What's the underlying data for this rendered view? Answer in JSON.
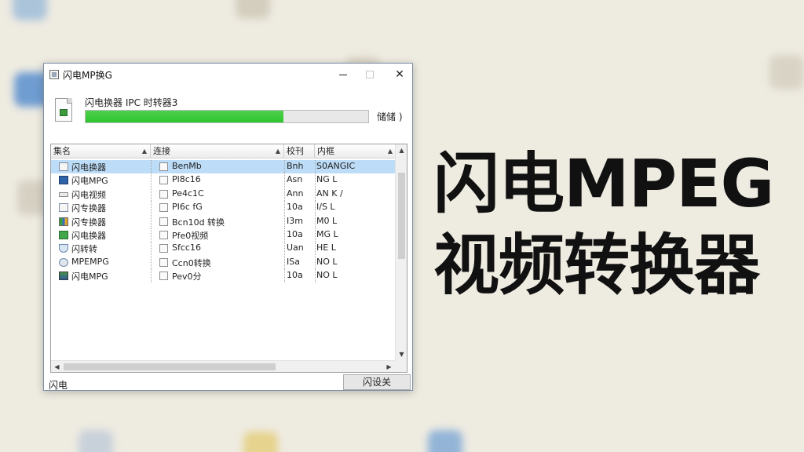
{
  "window": {
    "title": "闪电MP换G",
    "status_text": "闪电换器 IPC 时转器3",
    "progress_percent": 70,
    "progress_color": "#2ec42e",
    "detail_label": "储储 )",
    "footer_label": "闪电",
    "close_button_label": "闪设关"
  },
  "list": {
    "columns": [
      "集名",
      "连接",
      "校刊",
      "内框"
    ],
    "rows": [
      {
        "icon": "document-icon",
        "name": "闪电换器",
        "path": "BenMb",
        "type": "Bnh",
        "detail": "S0ANGIC",
        "selected": true
      },
      {
        "icon": "monitor-icon",
        "name": "闪电MPG",
        "path": "Pl8c16",
        "type": "Asn",
        "detail": "NG L",
        "selected": false
      },
      {
        "icon": "window-icon",
        "name": "闪电视频",
        "path": "Pe4c1C",
        "type": "Ann",
        "detail": "AN K /",
        "selected": false
      },
      {
        "icon": "document-icon",
        "name": "闪专换器",
        "path": "PI6c fG",
        "type": "10a",
        "detail": "I/S L",
        "selected": false
      },
      {
        "icon": "multi-color-icon",
        "name": "闪专换器",
        "path": "Bcn10d 转换",
        "type": "I3m",
        "detail": "M0 L",
        "selected": false
      },
      {
        "icon": "green-icon",
        "name": "闪电换器",
        "path": "Pfe0视频",
        "type": "10a",
        "detail": "MG L",
        "selected": false
      },
      {
        "icon": "shield-icon",
        "name": "闪转转",
        "path": "Sfcc16",
        "type": "Uan",
        "detail": "HE L",
        "selected": false
      },
      {
        "icon": "gear-icon",
        "name": "MPEMPG",
        "path": "Ccn0转换",
        "type": "ISa",
        "detail": "NO L",
        "selected": false
      },
      {
        "icon": "screen-icon",
        "name": "闪电MPG",
        "path": "Pev0分",
        "type": "10a",
        "detail": "NO L",
        "selected": false
      }
    ]
  },
  "overlay": {
    "line1": "闪电MPEG",
    "line2": "视频转换器"
  },
  "colors": {
    "background": "#eeebe1",
    "selection": "#bcdcf7"
  }
}
